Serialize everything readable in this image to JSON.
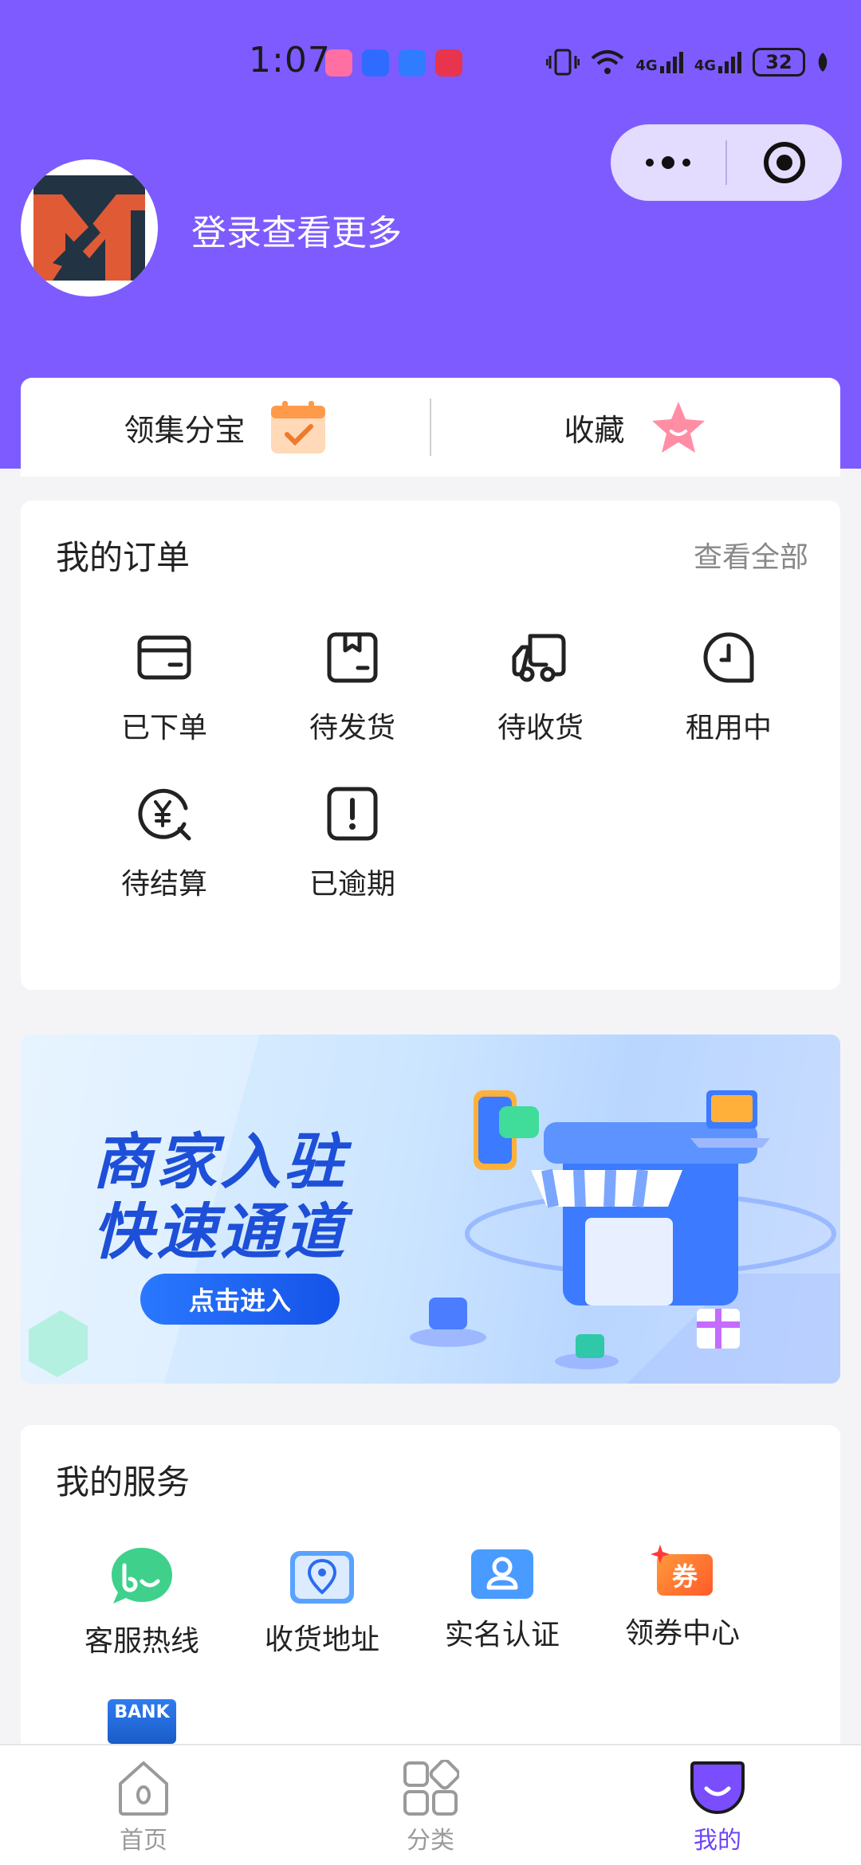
{
  "status_bar": {
    "time": "1:07",
    "network_1": "4G",
    "network_2": "4G",
    "battery": "32"
  },
  "profile": {
    "login_prompt": "登录查看更多"
  },
  "quick_links": [
    {
      "label": "领集分宝",
      "icon": "calendar-check-icon"
    },
    {
      "label": "收藏",
      "icon": "star-icon"
    }
  ],
  "orders": {
    "title": "我的订单",
    "view_all": "查看全部",
    "items": [
      {
        "label": "已下单",
        "icon": "card-icon"
      },
      {
        "label": "待发货",
        "icon": "box-icon"
      },
      {
        "label": "待收货",
        "icon": "truck-icon"
      },
      {
        "label": "租用中",
        "icon": "clock-icon"
      },
      {
        "label": "待结算",
        "icon": "yen-search-icon"
      },
      {
        "label": "已逾期",
        "icon": "alert-icon"
      }
    ]
  },
  "banner": {
    "line1": "商家入驻",
    "line2": "快速通道",
    "button": "点击进入"
  },
  "services": {
    "title": "我的服务",
    "items": [
      {
        "label": "客服热线",
        "icon": "chat-icon"
      },
      {
        "label": "收货地址",
        "icon": "location-icon"
      },
      {
        "label": "实名认证",
        "icon": "id-card-icon"
      },
      {
        "label": "领券中心",
        "icon": "coupon-icon",
        "icon_text": "券"
      },
      {
        "label": "",
        "icon": "bank-card-icon",
        "icon_text": "BANK"
      }
    ]
  },
  "tabbar": [
    {
      "label": "首页",
      "icon": "home-icon",
      "active": false
    },
    {
      "label": "分类",
      "icon": "category-icon",
      "active": false
    },
    {
      "label": "我的",
      "icon": "smile-icon",
      "active": true
    }
  ],
  "colors": {
    "brand": "#7e5bff",
    "active_tab": "#6d45f5",
    "banner_text": "#1d4fd8"
  }
}
